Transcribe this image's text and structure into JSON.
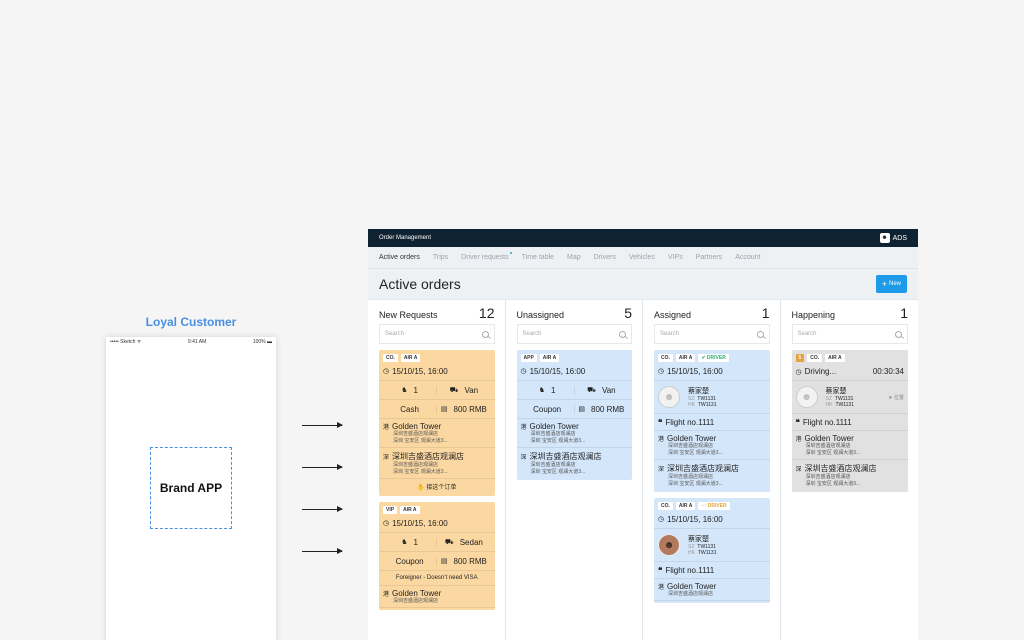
{
  "phone": {
    "label": "Loyal Customer",
    "status_left": "••••• Sketch ᯤ",
    "status_time": "9:41 AM",
    "status_right": "100% ▬",
    "brand": "Brand APP"
  },
  "app": {
    "title": "Order Management",
    "user": "ADS",
    "tabs": [
      "Active orders",
      "Trips",
      "Driver requests",
      "Time table",
      "Map",
      "Drivers",
      "Vehicles",
      "VIPs",
      "Partners",
      "Account"
    ],
    "page_title": "Active orders",
    "new_button": "New",
    "search_placeholder": "Search"
  },
  "columns": [
    {
      "title": "New Requests",
      "count": "12"
    },
    {
      "title": "Unassigned",
      "count": "5"
    },
    {
      "title": "Assigned",
      "count": "1"
    },
    {
      "title": "Happening",
      "count": "1"
    }
  ],
  "cards": {
    "new1": {
      "tags": [
        "CO.",
        "AIR A"
      ],
      "time": "15/10/15, 16:00",
      "pax": "1",
      "vehicle": "Van",
      "payment": "Cash",
      "price": "800 RMB",
      "from_char": "港",
      "from": "Golden Tower",
      "from_sub1": "深圳吉盛酒店观澜店",
      "from_sub2": "深圳 宝安区 观澜大道3...",
      "to_char": "深",
      "to": "深圳吉盛酒店观澜店",
      "to_sub1": "深圳吉盛酒店观澜店",
      "to_sub2": "深圳 宝安区 观澜大道3...",
      "accept": "接这个订单"
    },
    "new2": {
      "tags": [
        "VIP",
        "AIR A"
      ],
      "time": "15/10/15, 16:00",
      "pax": "1",
      "vehicle": "Sedan",
      "payment": "Coupon",
      "price": "800 RMB",
      "notice": "Foreigner - Doesn’t need VISA",
      "from_char": "港",
      "from": "Golden Tower",
      "from_sub1": "深圳吉盛酒店观澜店"
    },
    "un1": {
      "tags": [
        "APP",
        "AIR A"
      ],
      "time": "15/10/15, 16:00",
      "pax": "1",
      "vehicle": "Van",
      "payment": "Coupon",
      "price": "800 RMB",
      "from_char": "港",
      "from": "Golden Tower",
      "from_sub1": "深圳吉盛酒店观澜店",
      "from_sub2": "深圳 宝安区 观澜大道3...",
      "to_char": "深",
      "to": "深圳吉盛酒店观澜店",
      "to_sub1": "深圳吉盛酒店观澜店",
      "to_sub2": "深圳 宝安区 观澜大道3..."
    },
    "as1": {
      "tags": [
        "CO.",
        "AIR A"
      ],
      "driver_tag": "✔ DRIVER",
      "time": "15/10/15, 16:00",
      "driver_name": "蔡家楚",
      "sz_label": "SZ",
      "sz_plate": "TW1131",
      "hk_label": "HK",
      "hk_plate": "TW1131",
      "flight": "Flight no.1111",
      "from_char": "港",
      "from": "Golden Tower",
      "from_sub1": "深圳吉盛酒店观澜店",
      "from_sub2": "深圳 宝安区 观澜大道3...",
      "to_char": "深",
      "to": "深圳吉盛酒店观澜店",
      "to_sub1": "深圳吉盛酒店观澜店",
      "to_sub2": "深圳 宝安区 观澜大道3..."
    },
    "as2": {
      "tags": [
        "CO.",
        "AIR A"
      ],
      "driver_tag": "⋯ DRIVER",
      "time": "15/10/15, 16:00",
      "driver_name": "蔡家楚",
      "sz_label": "SZ",
      "sz_plate": "TW1131",
      "hk_label": "HK",
      "hk_plate": "TW1131",
      "flight": "Flight no.1111",
      "from_char": "港",
      "from": "Golden Tower",
      "from_sub1": "深圳吉盛酒店观澜店"
    },
    "hp1": {
      "num": "5",
      "tags": [
        "CO.",
        "AIR A"
      ],
      "status": "Driving...",
      "elapsed": "00:30:34",
      "driver_name": "蔡家楚",
      "sz_label": "SZ",
      "sz_plate": "TW1131",
      "hk_label": "HK",
      "hk_plate": "TW1131",
      "locate": "位置",
      "flight": "Flight no.1111",
      "from_char": "港",
      "from": "Golden Tower",
      "from_sub1": "深圳吉盛酒店观澜店",
      "from_sub2": "深圳 宝安区 观澜大道3...",
      "to_char": "深",
      "to": "深圳吉盛酒店观澜店",
      "to_sub1": "深圳吉盛酒店观澜店",
      "to_sub2": "深圳 宝安区 观澜大道3..."
    }
  },
  "colors": {
    "topbar": "#0f2231",
    "new_btn": "#1e9be8",
    "orange_card": "#fbd8a2",
    "blue_card": "#d3e6fa",
    "gray_card": "#e1e1e1",
    "accent_label": "#4a90e2"
  }
}
